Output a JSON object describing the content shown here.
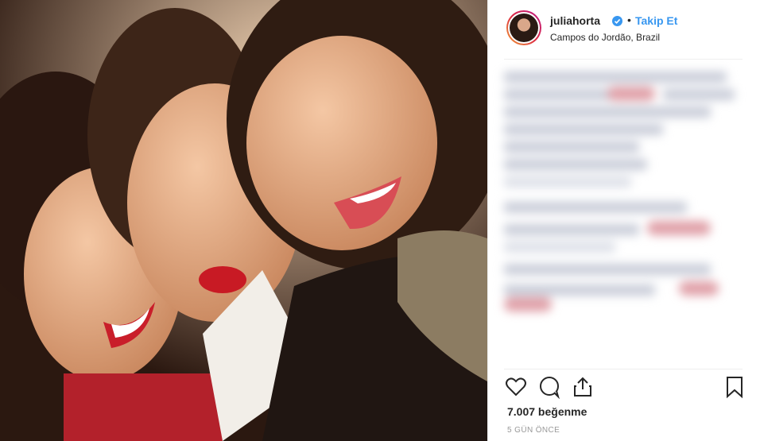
{
  "post": {
    "username": "juliahorta",
    "follow_separator": "•",
    "follow_label": "Takip Et",
    "location": "Campos do Jordão, Brazil",
    "likes": "7.007 beğenme",
    "time": "5 GÜN ÖNCE"
  },
  "colors": {
    "link": "#3897f0",
    "text": "#262626",
    "muted": "#999999",
    "divider": "#efefef"
  },
  "icons": {
    "verified": "verified-badge-icon",
    "like": "heart-icon",
    "comment": "comment-bubble-icon",
    "share": "share-upload-icon",
    "save": "bookmark-icon"
  }
}
